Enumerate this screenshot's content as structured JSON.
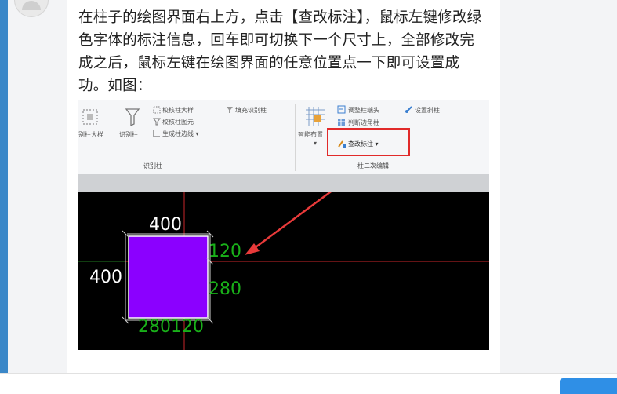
{
  "message": {
    "text": "在柱子的绘图界面右上方，点击【查改标注】，鼠标左键修改绿色字体的标注信息，回车即可切换下一个尺寸上，全部修改完成之后，鼠标左键在绘图界面的任意位置点一下即可设置成功。如图："
  },
  "ribbon": {
    "group_identify": {
      "title": "识别柱",
      "big_buttons": [
        "别柱大样",
        "识别柱"
      ],
      "small_buttons": [
        "校核柱大样",
        "校核柱图元",
        "生成柱边线 ▾",
        "填充识别柱"
      ]
    },
    "group_edit": {
      "title": "柱二次编辑",
      "big_button": "智能布置",
      "big_button_arrow": "▾",
      "small_buttons": [
        "调整柱端头",
        "判断边角柱",
        "设置斜柱"
      ],
      "highlight_button": "查改标注 ▾"
    }
  },
  "cad": {
    "top_dim": "400",
    "left_dim": "400",
    "right_dim_top": "120",
    "right_dim_bottom": "280",
    "bottom_dims": "280120",
    "column_color": "#8b00ff",
    "green": "#19b019"
  }
}
